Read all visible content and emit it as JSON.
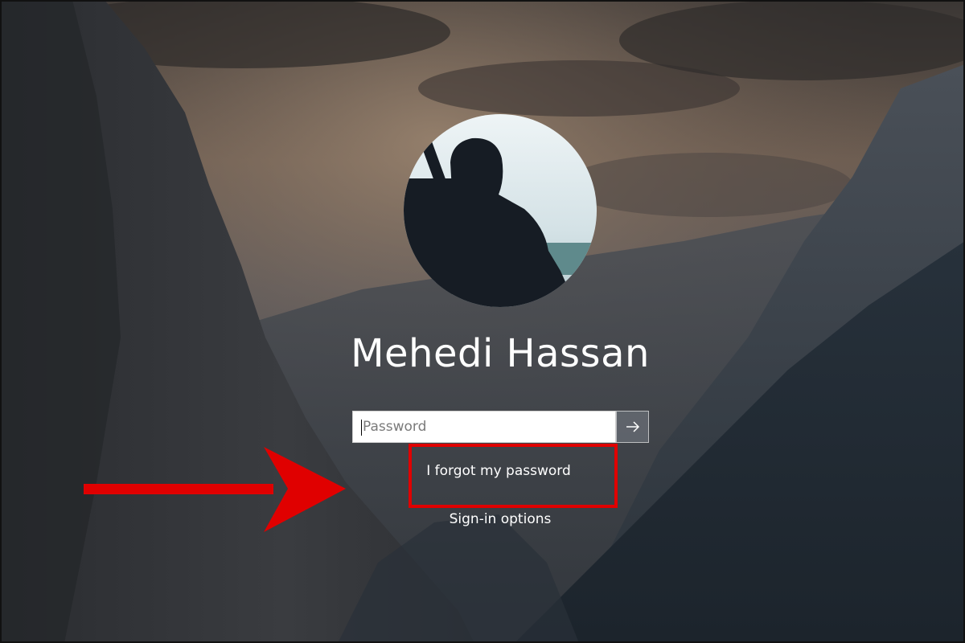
{
  "user": {
    "name": "Mehedi Hassan"
  },
  "password_field": {
    "placeholder": "Password",
    "value": ""
  },
  "submit_button": {
    "icon": "arrow-right-icon"
  },
  "links": {
    "forgot_password": "I forgot my password",
    "sign_in_options": "Sign-in options"
  },
  "annotation": {
    "arrow_color": "#e00000",
    "box_color": "#e00000"
  }
}
